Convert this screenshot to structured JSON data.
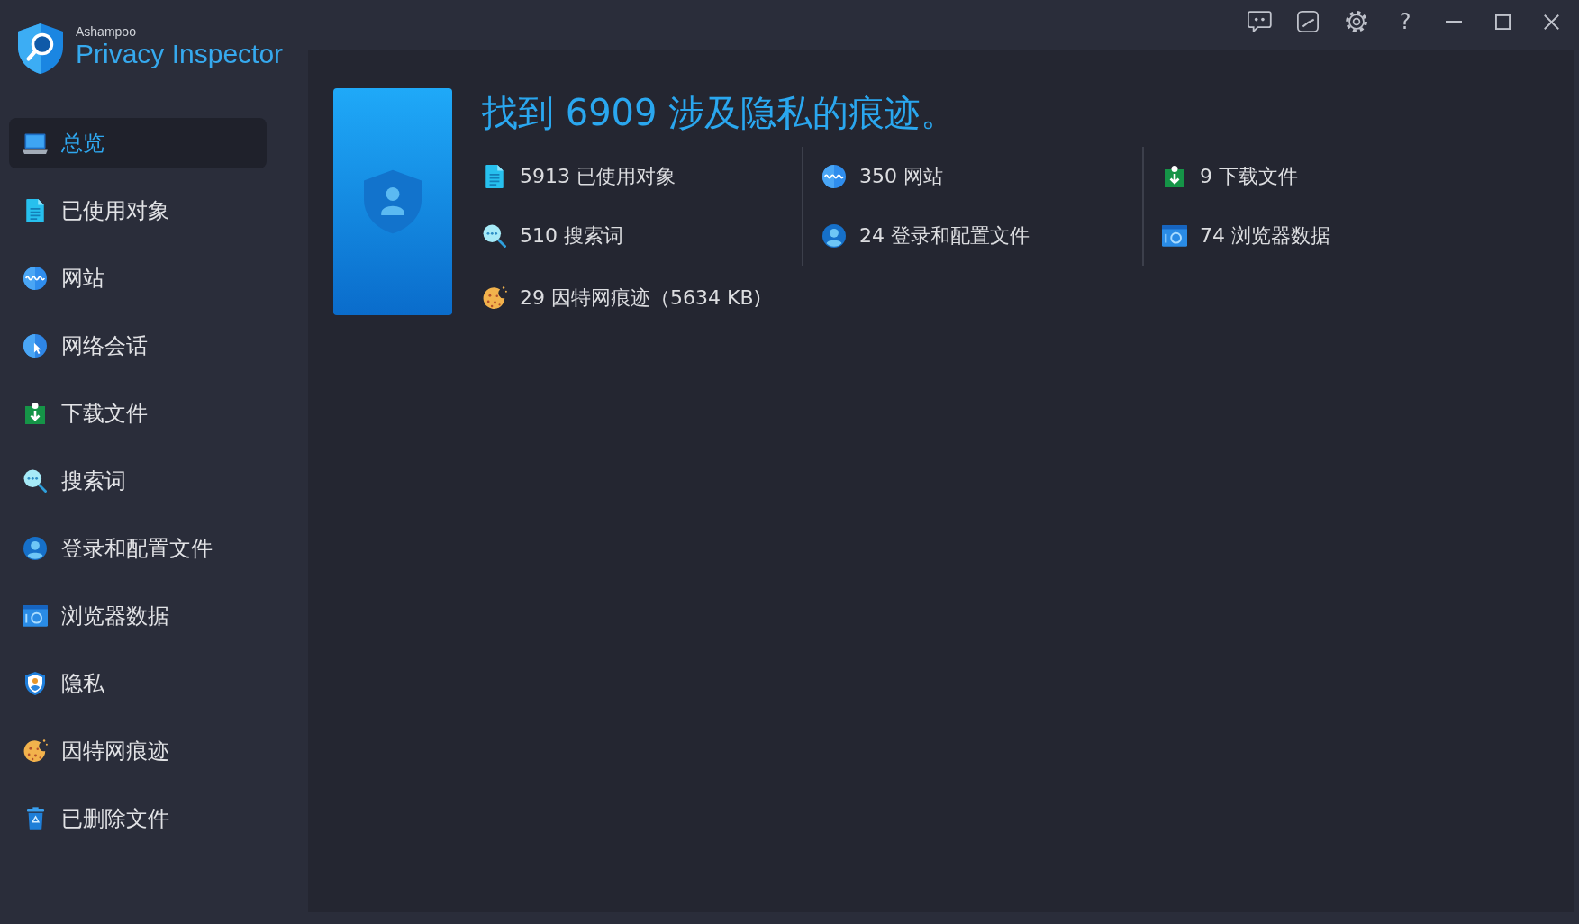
{
  "app": {
    "vendor": "Ashampoo",
    "name": "Privacy Inspector"
  },
  "title_bar": {
    "buttons": [
      {
        "kind": "feedback"
      },
      {
        "kind": "sketch"
      },
      {
        "kind": "settings"
      },
      {
        "kind": "help",
        "label": "?"
      },
      {
        "kind": "minimize"
      },
      {
        "kind": "maximize"
      },
      {
        "kind": "close"
      }
    ]
  },
  "sidebar": {
    "items": [
      {
        "kind": "overview",
        "label": "总览",
        "selected": true
      },
      {
        "kind": "objects",
        "label": "已使用对象",
        "selected": false
      },
      {
        "kind": "websites",
        "label": "网站",
        "selected": false
      },
      {
        "kind": "sessions",
        "label": "网络会话",
        "selected": false
      },
      {
        "kind": "downloads",
        "label": "下载文件",
        "selected": false
      },
      {
        "kind": "searches",
        "label": "搜索词",
        "selected": false
      },
      {
        "kind": "logins",
        "label": "登录和配置文件",
        "selected": false
      },
      {
        "kind": "browser",
        "label": "浏览器数据",
        "selected": false
      },
      {
        "kind": "privacy",
        "label": "隐私",
        "selected": false
      },
      {
        "kind": "cookies",
        "label": "因特网痕迹",
        "selected": false
      },
      {
        "kind": "deleted",
        "label": "已删除文件",
        "selected": false
      }
    ]
  },
  "summary": {
    "title": "找到 6909 涉及隐私的痕迹。",
    "stats": [
      {
        "kind": "objects",
        "text": "5913 已使用对象"
      },
      {
        "kind": "websites",
        "text": "350 网站"
      },
      {
        "kind": "downloads",
        "text": "9 下载文件"
      },
      {
        "kind": "searches",
        "text": "510 搜索词"
      },
      {
        "kind": "logins",
        "text": "24 登录和配置文件"
      },
      {
        "kind": "browser",
        "text": "74 浏览器数据"
      },
      {
        "kind": "cookies",
        "text": "29 因特网痕迹（5634 KB)"
      }
    ]
  }
}
